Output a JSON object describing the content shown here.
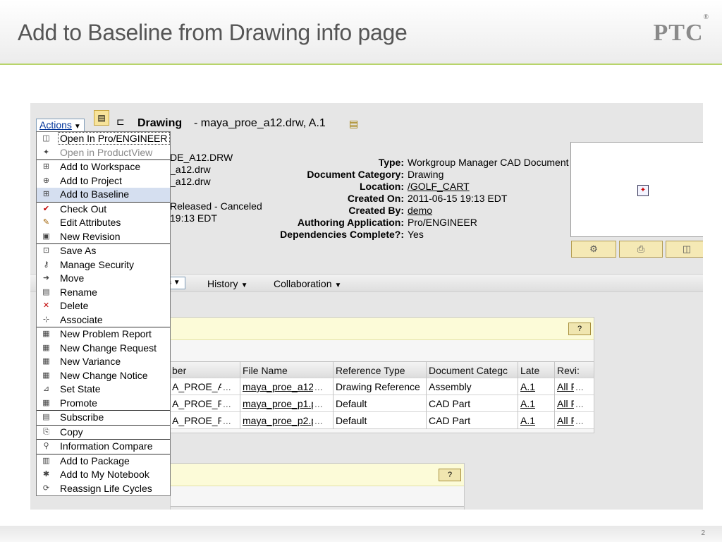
{
  "slide": {
    "title": "Add to Baseline from Drawing info page",
    "logo_text": "PTC",
    "logo_mark": "®",
    "page_number": "2"
  },
  "toolbar": {
    "actions_label": "Actions",
    "object_type": "Drawing",
    "object_name": "- maya_proe_a12.drw, A.1"
  },
  "partial_text": {
    "number": "DE_A12.DRW",
    "name1": "_a12.drw",
    "name2": "_a12.drw",
    "state": "Released - Canceled",
    "modified": "19:13 EDT"
  },
  "attributes": [
    {
      "label": "Type:",
      "value": "Workgroup Manager CAD Document",
      "link": false
    },
    {
      "label": "Document Category:",
      "value": "Drawing",
      "link": false
    },
    {
      "label": "Location:",
      "value": "/GOLF_CART",
      "link": true
    },
    {
      "label": "Created On:",
      "value": "2011-06-15 19:13 EDT",
      "link": false
    },
    {
      "label": "Created By:",
      "value": "demo",
      "link": true
    },
    {
      "label": "Authoring Application:",
      "value": "Pro/ENGINEER",
      "link": false
    },
    {
      "label": "Dependencies Complete?:",
      "value": "Yes",
      "link": false
    }
  ],
  "tabs": [
    {
      "label": "History"
    },
    {
      "label": "Collaboration"
    }
  ],
  "references_table": {
    "help_label": "?",
    "columns": [
      "ber",
      "File Name",
      "Reference Type",
      "Document Categc",
      "Late",
      "Revi:"
    ],
    "rows": [
      [
        "A_PROE_A'",
        "maya_proe_a12.:",
        "Drawing Reference",
        "Assembly",
        "A.1",
        "All F"
      ],
      [
        "A_PROE_P",
        "maya_proe_p1.prt",
        "Default",
        "CAD Part",
        "A.1",
        "All F"
      ],
      [
        "A_PROE_P:",
        "maya_proe_p2.prt",
        "Default",
        "CAD Part",
        "A.1",
        "All F"
      ]
    ],
    "ellipsis": "..."
  },
  "panel2": {
    "help_label": "?"
  },
  "actions_menu": {
    "groups": [
      [
        {
          "label": "Open In Pro/ENGINEER",
          "icon": "open-proe-icon",
          "glyph": "◫",
          "disabled": false
        },
        {
          "label": "Open in ProductView",
          "icon": "productview-icon",
          "glyph": "✦",
          "disabled": true
        }
      ],
      [
        {
          "label": "Add to Workspace",
          "icon": "add-workspace-icon",
          "glyph": "⊞",
          "disabled": false
        },
        {
          "label": "Add to Project",
          "icon": "add-project-icon",
          "glyph": "⊕",
          "disabled": false
        },
        {
          "label": "Add to Baseline",
          "icon": "add-baseline-icon",
          "glyph": "⊞",
          "disabled": false,
          "selected": true
        }
      ],
      [
        {
          "label": "Check Out",
          "icon": "check-out-icon",
          "glyph": "✔",
          "disabled": false
        },
        {
          "label": "Edit Attributes",
          "icon": "edit-attributes-icon",
          "glyph": "✎",
          "disabled": false
        },
        {
          "label": "New Revision",
          "icon": "new-revision-icon",
          "glyph": "▣",
          "disabled": false
        }
      ],
      [
        {
          "label": "Save As",
          "icon": "save-as-icon",
          "glyph": "⊡",
          "disabled": false
        },
        {
          "label": "Manage Security",
          "icon": "key-icon",
          "glyph": "⚷",
          "disabled": false
        },
        {
          "label": "Move",
          "icon": "move-icon",
          "glyph": "➜",
          "disabled": false
        },
        {
          "label": "Rename",
          "icon": "rename-icon",
          "glyph": "▤",
          "disabled": false
        },
        {
          "label": "Delete",
          "icon": "delete-icon",
          "glyph": "✕",
          "disabled": false
        },
        {
          "label": "Associate",
          "icon": "associate-icon",
          "glyph": "⊹",
          "disabled": false
        }
      ],
      [
        {
          "label": "New Problem Report",
          "icon": "problem-report-icon",
          "glyph": "▦",
          "disabled": false
        },
        {
          "label": "New Change Request",
          "icon": "change-request-icon",
          "glyph": "▦",
          "disabled": false
        },
        {
          "label": "New Variance",
          "icon": "variance-icon",
          "glyph": "▦",
          "disabled": false
        },
        {
          "label": "New Change Notice",
          "icon": "change-notice-icon",
          "glyph": "▦",
          "disabled": false
        },
        {
          "label": "Set State",
          "icon": "set-state-icon",
          "glyph": "⊿",
          "disabled": false
        },
        {
          "label": "Promote",
          "icon": "promote-icon",
          "glyph": "▦",
          "disabled": false
        }
      ],
      [
        {
          "label": "Subscribe",
          "icon": "subscribe-icon",
          "glyph": "▤",
          "disabled": false
        }
      ],
      [
        {
          "label": "Copy",
          "icon": "copy-icon",
          "glyph": "⎘",
          "disabled": false
        }
      ],
      [
        {
          "label": "Information Compare",
          "icon": "compare-icon",
          "glyph": "⚲",
          "disabled": false
        }
      ],
      [
        {
          "label": "Add to Package",
          "icon": "add-package-icon",
          "glyph": "▥",
          "disabled": false
        },
        {
          "label": "Add to My Notebook",
          "icon": "notebook-icon",
          "glyph": "✱",
          "disabled": false
        },
        {
          "label": "Reassign Life Cycles",
          "icon": "life-cycle-icon",
          "glyph": "⟳",
          "disabled": false
        }
      ]
    ]
  },
  "colors": {
    "accent_link": "#003399",
    "selected_menu": "#d5dff0",
    "panel_header": "#fcfbd8",
    "header_rule": "#b8d46a"
  }
}
